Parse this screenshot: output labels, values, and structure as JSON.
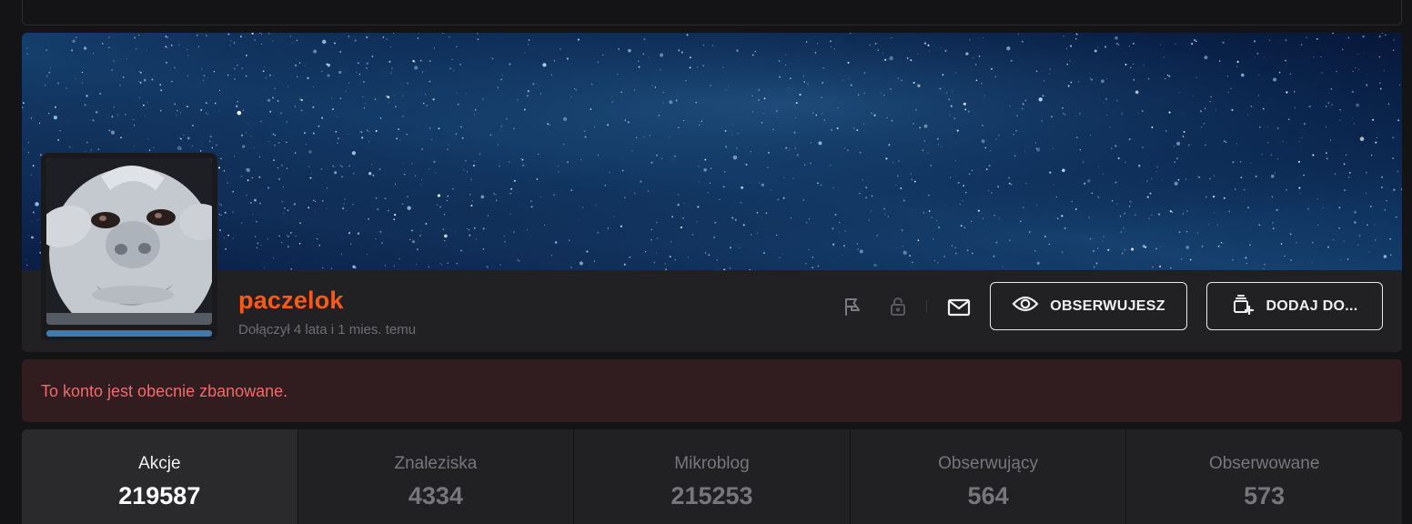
{
  "profile": {
    "username": "paczelok",
    "joined": "Dołączył 4 lata i 1 mies. temu",
    "username_color": "#ff5917"
  },
  "actions": {
    "report_icon": "flag-icon",
    "block_icon": "lock-icon",
    "message_icon": "mail-icon",
    "observe_label": "OBSERWUJESZ",
    "observe_icon": "eye-icon",
    "add_to_label": "DODAJ DO...",
    "add_to_icon": "playlist-add-icon"
  },
  "notice": {
    "text": "To konto jest obecnie zbanowane.",
    "color": "#f06a6a"
  },
  "stats": [
    {
      "label": "Akcje",
      "value": "219587"
    },
    {
      "label": "Znaleziska",
      "value": "4334"
    },
    {
      "label": "Mikroblog",
      "value": "215253"
    },
    {
      "label": "Obserwujący",
      "value": "564"
    },
    {
      "label": "Obserwowane",
      "value": "573"
    }
  ]
}
